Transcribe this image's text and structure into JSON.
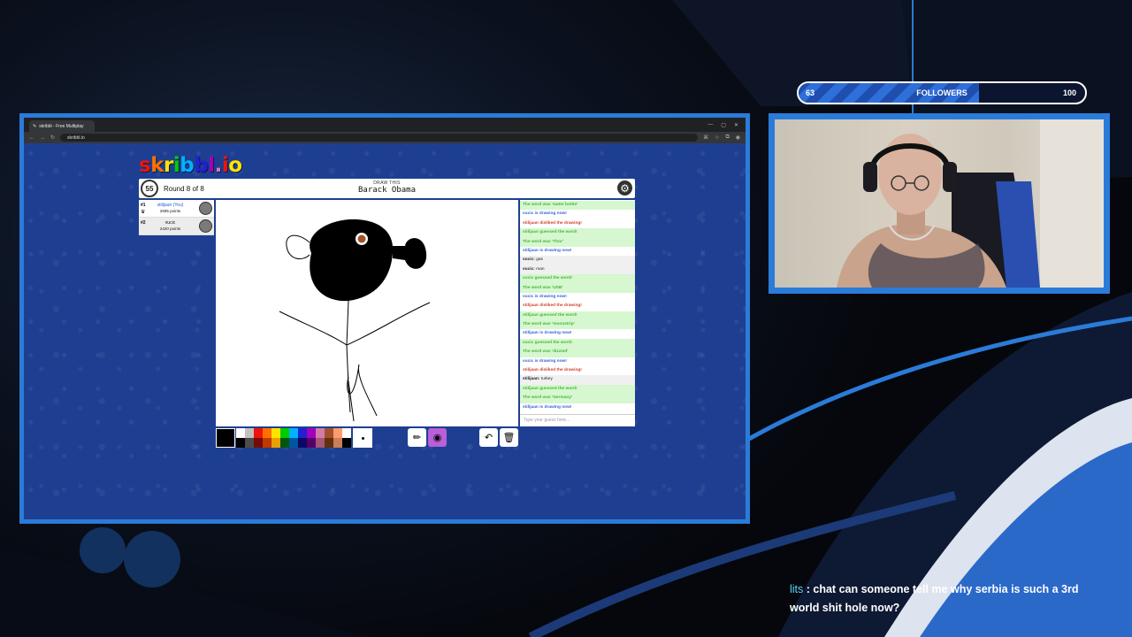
{
  "browser": {
    "tab_title": "skribbl - Free Multiplay",
    "url": "skribbl.io"
  },
  "game": {
    "logo": "skribbl.io",
    "timer": "55",
    "round": "Round 8 of 8",
    "word_hint": "DRAW THIS",
    "word": "Barack Obama",
    "players": [
      {
        "rank": "#1",
        "name": "stilijaan (You)",
        "points": "2695 points"
      },
      {
        "rank": "#2",
        "name": "vucic",
        "points": "2420 points"
      }
    ],
    "chat": [
      {
        "type": "green",
        "text": "The word was 'water bottle'"
      },
      {
        "type": "blue",
        "text": "vucic is drawing now!"
      },
      {
        "type": "red",
        "text": "stilijaan disliked the drawing!"
      },
      {
        "type": "green",
        "text": "stilijaan guessed the word!"
      },
      {
        "type": "green",
        "text": "The word was 'Thor'"
      },
      {
        "type": "blue",
        "text": "stilijaan is drawing now!"
      },
      {
        "type": "black",
        "user": "vucic:",
        "text": "gas"
      },
      {
        "type": "black",
        "user": "vucic:",
        "text": "man"
      },
      {
        "type": "green",
        "text": "vucic guessed the word!"
      },
      {
        "type": "green",
        "text": "The word was 'USB'"
      },
      {
        "type": "blue",
        "text": "vucic is drawing now!"
      },
      {
        "type": "red",
        "text": "stilijaan disliked the drawing!"
      },
      {
        "type": "green",
        "text": "stilijaan guessed the word!"
      },
      {
        "type": "green",
        "text": "The word was 'moonstrip'"
      },
      {
        "type": "blue",
        "text": "stilijaan is drawing now!"
      },
      {
        "type": "green",
        "text": "vucic guessed the word!"
      },
      {
        "type": "green",
        "text": "The word was 'dizzied'"
      },
      {
        "type": "blue",
        "text": "vucic is drawing now!"
      },
      {
        "type": "red",
        "text": "stilijaan disliked the drawing!"
      },
      {
        "type": "black",
        "user": "stilijaan:",
        "text": "turkey"
      },
      {
        "type": "green",
        "text": "stilijaan guessed the word!"
      },
      {
        "type": "green",
        "text": "The word was 'Germany'"
      },
      {
        "type": "blue",
        "text": "stilijaan is drawing now!"
      }
    ],
    "chat_placeholder": "Type your guess here...",
    "palette": [
      "#ffffff",
      "#c1c1c1",
      "#ef130b",
      "#ff7100",
      "#ffe400",
      "#00cc00",
      "#00b2ff",
      "#231fd3",
      "#a300ba",
      "#d37caa",
      "#a0522d",
      "#ff9c6b",
      "#ffffff",
      "#000000",
      "#4c4c4c",
      "#740b07",
      "#c23800",
      "#e8a200",
      "#005510",
      "#00569e",
      "#0e0865",
      "#550069",
      "#a75574",
      "#63300d",
      "#cb7e57",
      "#000000"
    ],
    "colors": {
      "accent_blue": "#2b7bd8",
      "page_blue": "#1e3f91"
    }
  },
  "stream": {
    "followers_current": "63",
    "followers_label": "FOLLOWERS",
    "followers_goal": "100",
    "followers_progress": 0.63,
    "chat_user": "lits",
    "chat_sep": " : ",
    "chat_text": "chat can someone tell me why serbia is such a 3rd world shit hole now?"
  }
}
